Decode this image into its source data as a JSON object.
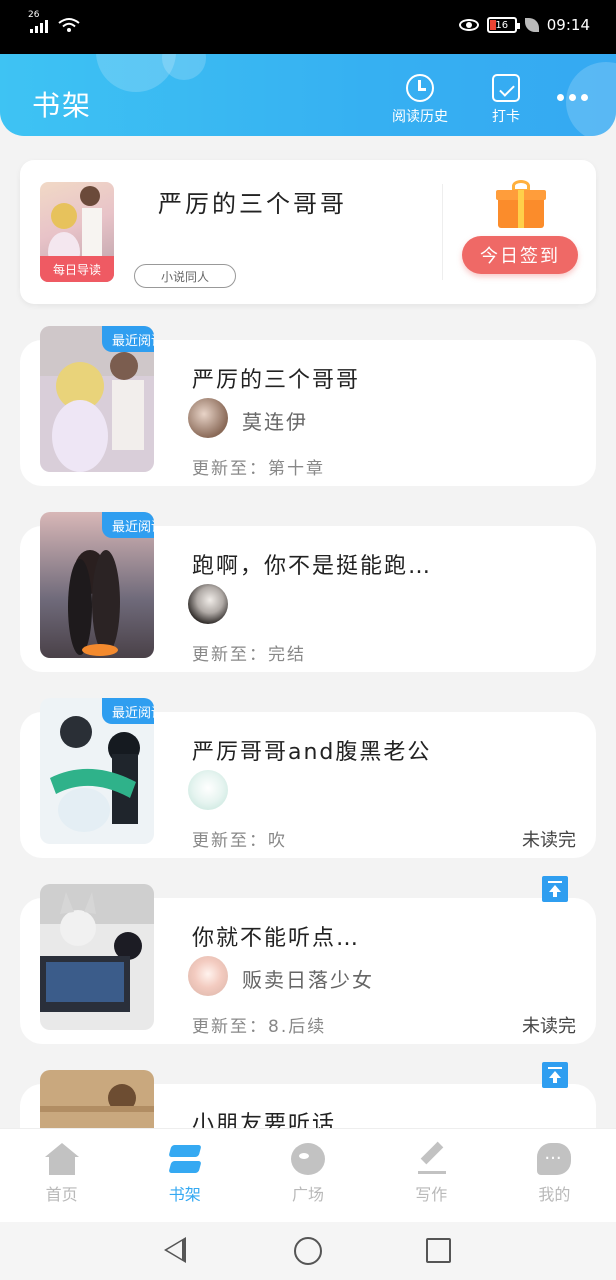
{
  "status_bar": {
    "network": "26",
    "battery": "16",
    "time": "09:14"
  },
  "header": {
    "title": "书架",
    "history_label": "阅读历史",
    "checkin_label": "打卡"
  },
  "daily_card": {
    "cover_badge": "每日导读",
    "book_title": "严厉的三个哥哥",
    "tag": "小说同人",
    "checkin_button": "今日签到"
  },
  "books": [
    {
      "title": "严厉的三个哥哥",
      "recent_tag": "最近阅读",
      "author": "莫连伊",
      "update_prefix": "更新至：",
      "update_value": "第十章",
      "unread": "",
      "pinned": false
    },
    {
      "title": "跑啊，你不是挺能跑…",
      "recent_tag": "最近阅读",
      "author": "",
      "update_prefix": "更新至：",
      "update_value": "完结",
      "unread": "",
      "pinned": false
    },
    {
      "title": "严厉哥哥and腹黑老公",
      "recent_tag": "最近阅读",
      "author": "",
      "update_prefix": "更新至：",
      "update_value": "吹",
      "unread": "未读完",
      "pinned": false
    },
    {
      "title": "你就不能听点…",
      "recent_tag": "",
      "author": "贩卖日落少女",
      "update_prefix": "更新至：",
      "update_value": "8.后续",
      "unread": "未读完",
      "pinned": true
    },
    {
      "title": "小朋友要听话",
      "recent_tag": "",
      "author": "",
      "update_prefix": "",
      "update_value": "",
      "unread": "",
      "pinned": true
    }
  ],
  "bottom_nav": [
    {
      "label": "首页",
      "icon": "home-icon",
      "active": false
    },
    {
      "label": "书架",
      "icon": "bookshelf-icon",
      "active": true
    },
    {
      "label": "广场",
      "icon": "plaza-icon",
      "active": false
    },
    {
      "label": "写作",
      "icon": "write-icon",
      "active": false
    },
    {
      "label": "我的",
      "icon": "profile-icon",
      "active": false
    }
  ],
  "colors": {
    "accent": "#35a9f2",
    "checkin": "#ef6966",
    "tag_blue": "#2f9ef0"
  }
}
